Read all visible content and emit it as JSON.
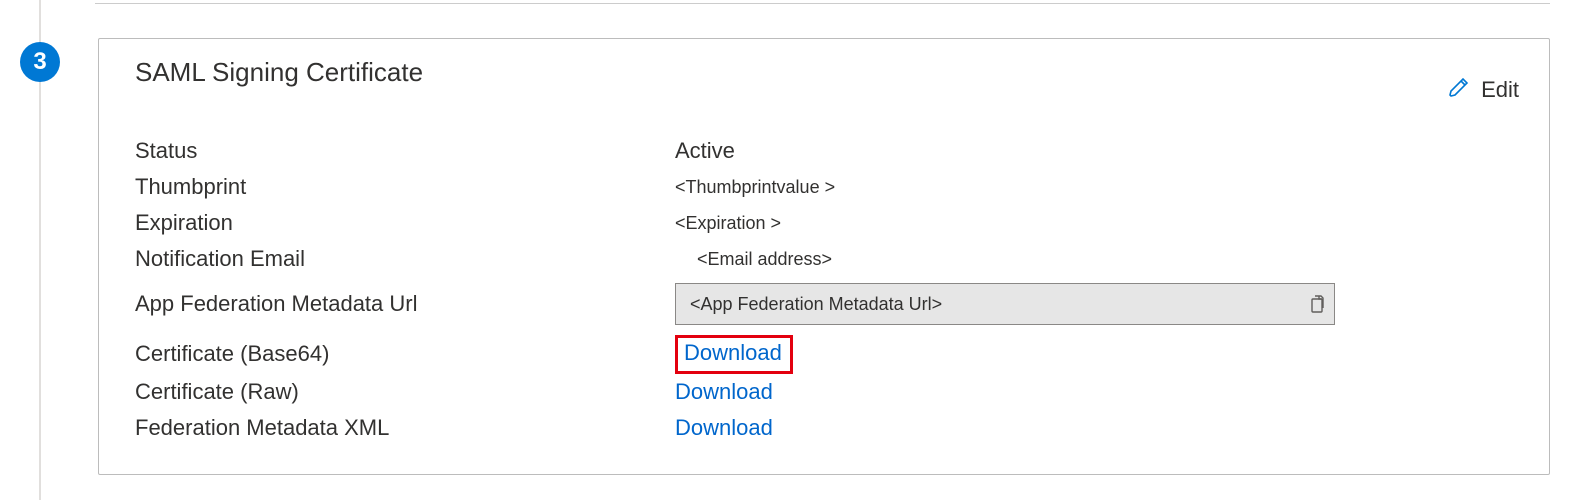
{
  "step_number": "3",
  "card": {
    "title": "SAML Signing Certificate",
    "edit_label": "Edit"
  },
  "fields": {
    "status": {
      "label": "Status",
      "value": "Active"
    },
    "thumbprint": {
      "label": "Thumbprint",
      "value": "<Thumbprintvalue >"
    },
    "expiration": {
      "label": "Expiration",
      "value": "<Expiration >"
    },
    "notification_email": {
      "label": "Notification Email",
      "value": "<Email address>"
    },
    "metadata_url": {
      "label": "App Federation Metadata Url",
      "value": "<App Federation Metadata Url>"
    },
    "cert_base64": {
      "label": "Certificate (Base64)",
      "link": "Download"
    },
    "cert_raw": {
      "label": "Certificate (Raw)",
      "link": "Download"
    },
    "fed_xml": {
      "label": "Federation Metadata XML",
      "link": "Download"
    }
  }
}
